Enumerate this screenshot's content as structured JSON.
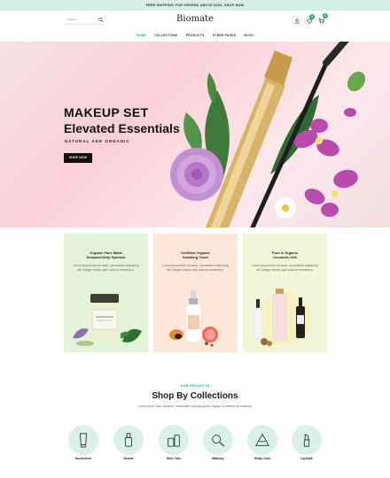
{
  "announcement": "FREE SHIPPING FOR ORDERS ABOVE $200, SHOP NOW",
  "search": {
    "placeholder": "Search"
  },
  "brand": "Biomate",
  "header_badges": {
    "wishlist": "0",
    "cart": "0"
  },
  "nav": [
    "HOME",
    "COLLECTIONS",
    "PRODUCTS",
    "OTHER PAGES",
    "BLOG"
  ],
  "hero": {
    "line1": "MAKEUP SET",
    "line2": "Elevated Essentials",
    "subtitle": "NATURAL AND ORGANIC",
    "button": "SHOP NOW"
  },
  "cards": [
    {
      "title1": "Organic Face Mask",
      "title2": "Seaweed-Kelp Spinach",
      "desc": "Lorem ipsum dolor sit amet, consectetur adipiscing elit. Integer ultrices quis nulla ac fermentum.",
      "bg": "#e3f3da"
    },
    {
      "title1": "Certified Organic",
      "title2": "Soothing Toner",
      "desc": "Lorem ipsum dolor sit amet, consectetur adipiscing elit. Integer ultrices quis nulla ac fermentum.",
      "bg": "#fde7d8"
    },
    {
      "title1": "Pure & Organic",
      "title2": "Cosmetic Oils",
      "desc": "Lorem ipsum dolor sit amet, consectetur adipiscing elit. Integer ultrices quis nulla ac fermentum.",
      "bg": "#f1f6d8"
    }
  ],
  "section": {
    "eyebrow": "OUR PRODUCTS",
    "title": "Shop By Collections",
    "desc": "Lorem ipsum dolor sit amet, consectetur adipiscing elit. Integer ut eleifend sit euismod."
  },
  "collections": [
    {
      "label": "Sunscreen",
      "icon": "sunscreen-tube-icon"
    },
    {
      "label": "Serum",
      "icon": "serum-dropper-icon"
    },
    {
      "label": "Skin Care",
      "icon": "skin-care-icon"
    },
    {
      "label": "Makeup",
      "icon": "makeup-brush-icon"
    },
    {
      "label": "Body Care",
      "icon": "body-care-icon"
    },
    {
      "label": "Lipstick",
      "icon": "lipstick-icon"
    }
  ],
  "colors": {
    "accent": "#2ea67d",
    "announce_bg": "#d6efe6",
    "hero_bg": "#fbd0d8"
  }
}
